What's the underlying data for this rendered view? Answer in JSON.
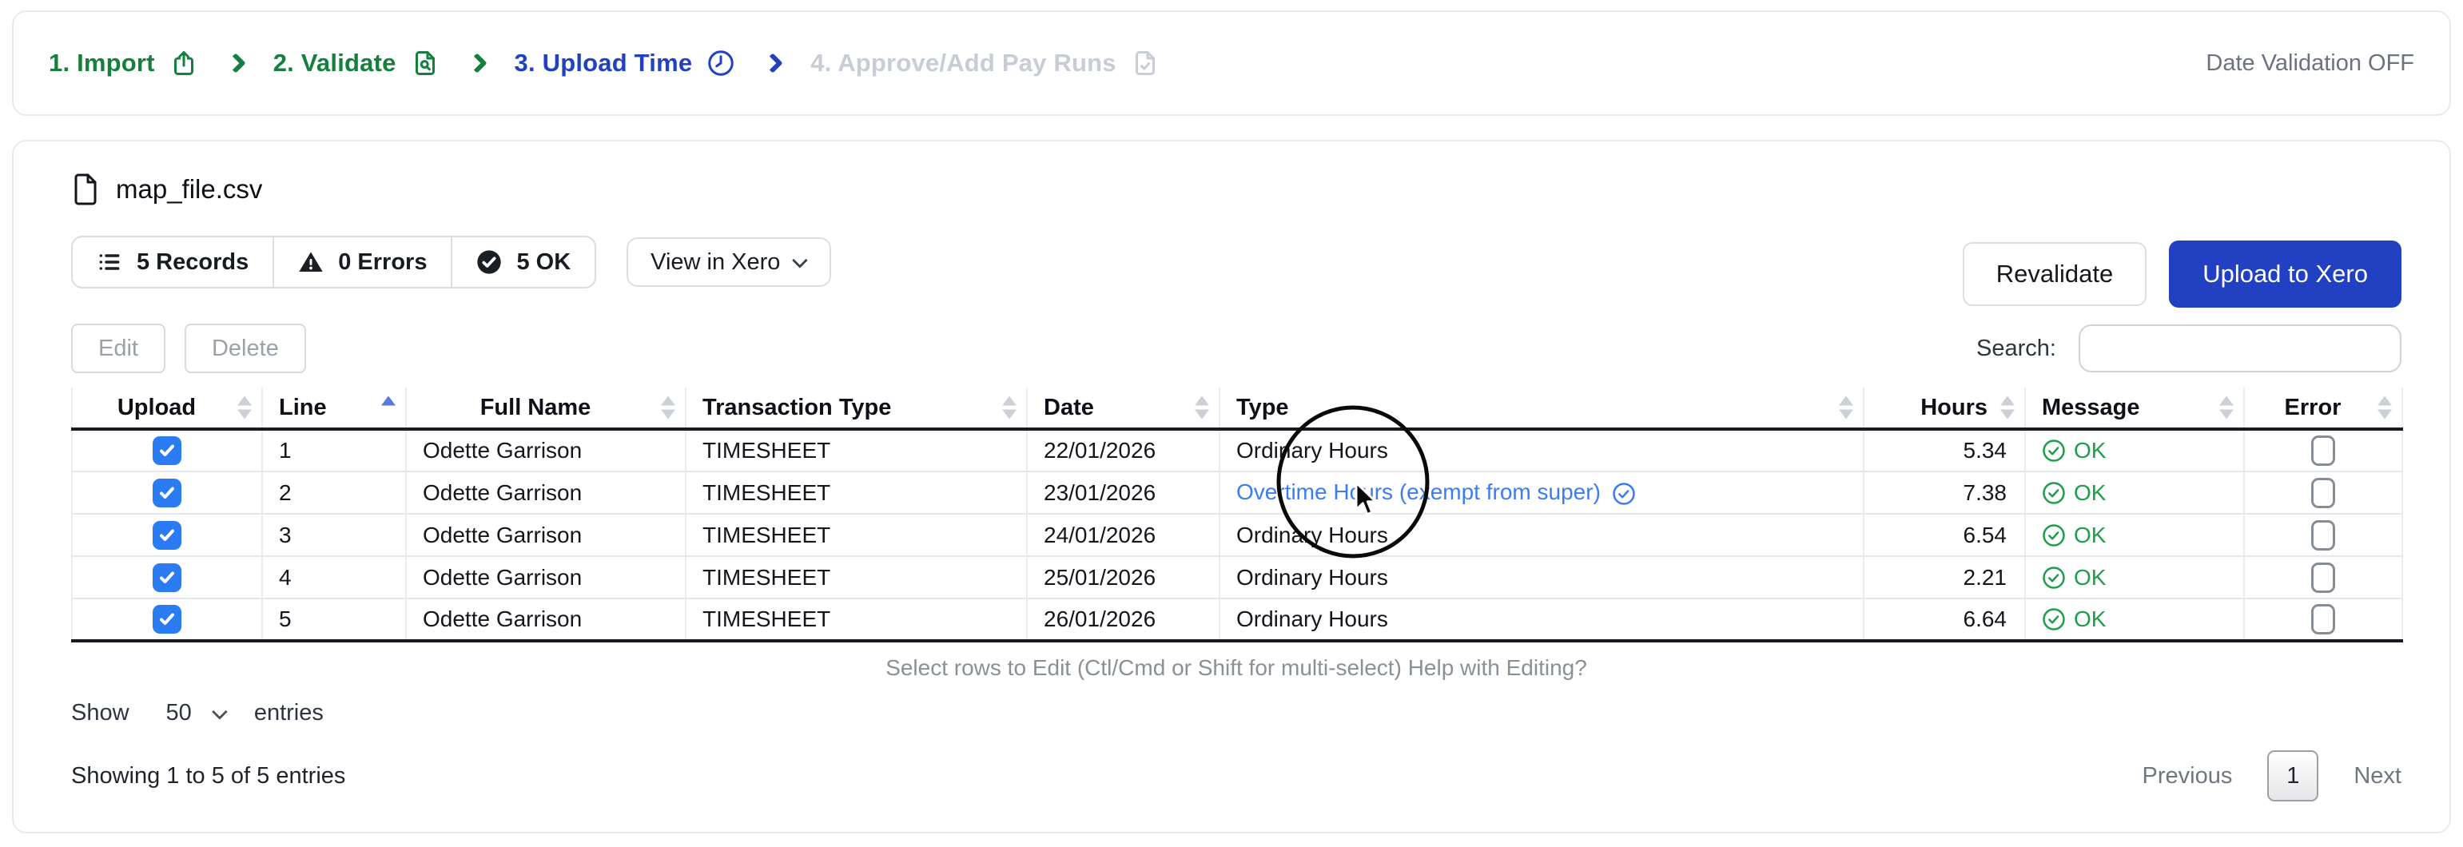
{
  "colors": {
    "step_done": "#15803d",
    "step_active": "#1f41c2",
    "step_upcoming": "#c7cdd6",
    "primary_button": "#2140c2",
    "link_blue": "#3c7cf3",
    "ok_green": "#1e9e4b",
    "checkbox_blue": "#2b7bf3",
    "sort_active_blue": "#5b76dd"
  },
  "stepper": {
    "steps": [
      {
        "label": "1. Import",
        "icon": "upload-icon",
        "state": "done"
      },
      {
        "label": "2. Validate",
        "icon": "document-search-icon",
        "state": "done"
      },
      {
        "label": "3. Upload Time",
        "icon": "clock-icon",
        "state": "active"
      },
      {
        "label": "4. Approve/Add Pay Runs",
        "icon": "document-check-icon",
        "state": "upcoming"
      }
    ],
    "date_validation_label": "Date Validation OFF"
  },
  "file_panel": {
    "filename": "map_file.csv",
    "badges": {
      "records": "5 Records",
      "errors": "0 Errors",
      "ok": "5 OK"
    },
    "view_in_xero_label": "View in Xero",
    "revalidate_label": "Revalidate",
    "upload_label": "Upload to Xero"
  },
  "toolbar": {
    "edit_label": "Edit",
    "delete_label": "Delete",
    "search_label": "Search:",
    "search_value": ""
  },
  "table": {
    "columns": [
      {
        "label": "Upload"
      },
      {
        "label": "Line"
      },
      {
        "label": "Full Name"
      },
      {
        "label": "Transaction Type"
      },
      {
        "label": "Date"
      },
      {
        "label": "Type"
      },
      {
        "label": "Hours"
      },
      {
        "label": "Message"
      },
      {
        "label": "Error"
      }
    ],
    "rows": [
      {
        "upload_checked": true,
        "line": "1",
        "full_name": "Odette Garrison",
        "transaction_type": "TIMESHEET",
        "date": "22/01/2026",
        "type": "Ordinary Hours",
        "type_is_link": false,
        "hours": "5.34",
        "message": "OK",
        "error_checked": false
      },
      {
        "upload_checked": true,
        "line": "2",
        "full_name": "Odette Garrison",
        "transaction_type": "TIMESHEET",
        "date": "23/01/2026",
        "type": "Overtime Hours (exempt from super)",
        "type_is_link": true,
        "hours": "7.38",
        "message": "OK",
        "error_checked": false
      },
      {
        "upload_checked": true,
        "line": "3",
        "full_name": "Odette Garrison",
        "transaction_type": "TIMESHEET",
        "date": "24/01/2026",
        "type": "Ordinary Hours",
        "type_is_link": false,
        "hours": "6.54",
        "message": "OK",
        "error_checked": false
      },
      {
        "upload_checked": true,
        "line": "4",
        "full_name": "Odette Garrison",
        "transaction_type": "TIMESHEET",
        "date": "25/01/2026",
        "type": "Ordinary Hours",
        "type_is_link": false,
        "hours": "2.21",
        "message": "OK",
        "error_checked": false
      },
      {
        "upload_checked": true,
        "line": "5",
        "full_name": "Odette Garrison",
        "transaction_type": "TIMESHEET",
        "date": "26/01/2026",
        "type": "Ordinary Hours",
        "type_is_link": false,
        "hours": "6.64",
        "message": "OK",
        "error_checked": false
      }
    ],
    "hint": "Select rows to Edit (Ctl/Cmd or Shift for multi-select) Help with Editing?"
  },
  "pagination": {
    "show_label": "Show",
    "page_size": "50",
    "entries_label": "entries",
    "summary": "Showing 1 to 5 of 5 entries",
    "previous_label": "Previous",
    "page": "1",
    "next_label": "Next"
  }
}
